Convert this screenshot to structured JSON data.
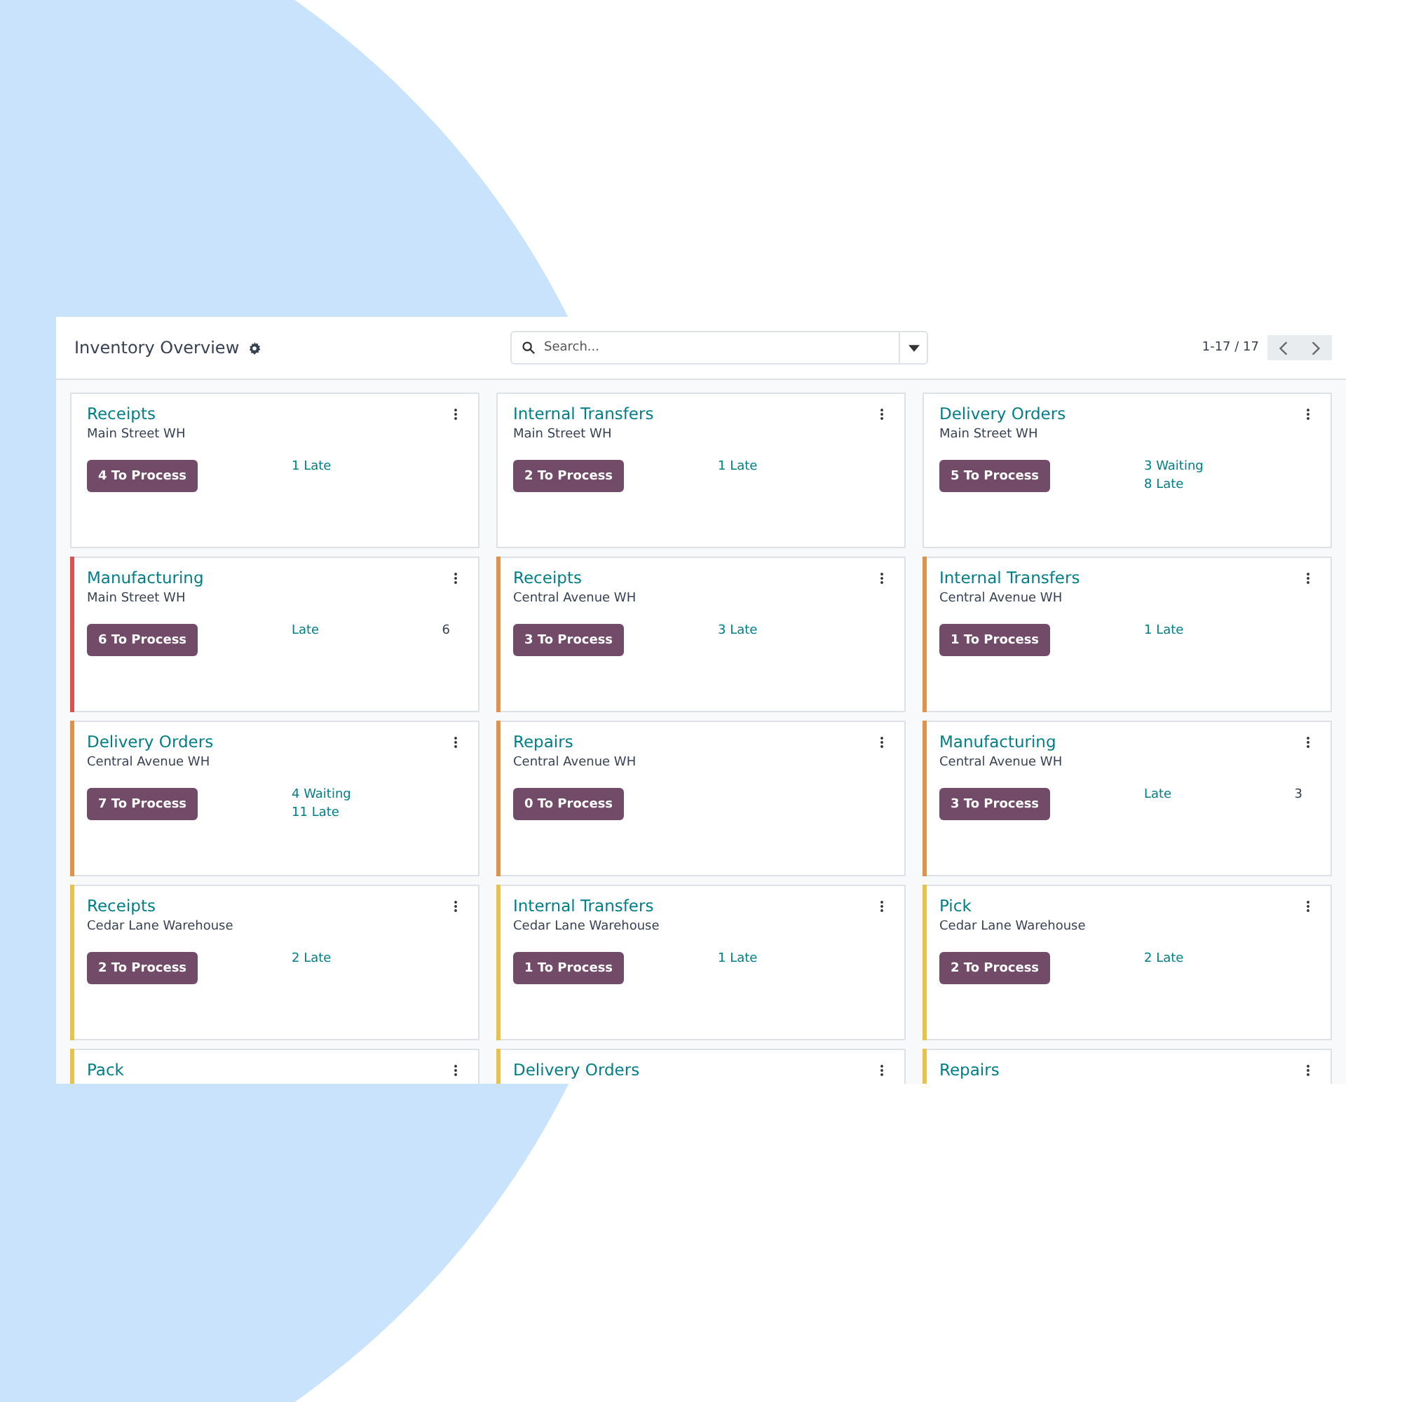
{
  "window": {
    "title": "Inventory Overview"
  },
  "search": {
    "placeholder": "Search..."
  },
  "pager": {
    "range": "1-17 / 17"
  },
  "cards": [
    {
      "title": "Receipts",
      "warehouse": "Main Street WH",
      "button": "4 To Process",
      "stats": [
        {
          "label": "1 Late"
        }
      ]
    },
    {
      "title": "Internal Transfers",
      "warehouse": "Main Street WH",
      "button": "2 To Process",
      "stats": [
        {
          "label": "1 Late"
        }
      ]
    },
    {
      "title": "Delivery Orders",
      "warehouse": "Main Street WH",
      "button": "5 To Process",
      "stats": [
        {
          "label": "3 Waiting"
        },
        {
          "label": "8 Late"
        }
      ]
    },
    {
      "title": "Manufacturing",
      "warehouse": "Main Street WH",
      "button": "6 To Process",
      "color": "#d9534f",
      "stats": [
        {
          "label": "Late",
          "count": "6"
        }
      ]
    },
    {
      "title": "Receipts",
      "warehouse": "Central Avenue WH",
      "button": "3 To Process",
      "color": "#e0924a",
      "stats": [
        {
          "label": "3 Late"
        }
      ]
    },
    {
      "title": "Internal Transfers",
      "warehouse": "Central Avenue WH",
      "button": "1 To Process",
      "color": "#e0924a",
      "stats": [
        {
          "label": "1 Late"
        }
      ]
    },
    {
      "title": "Delivery Orders",
      "warehouse": "Central Avenue WH",
      "button": "7 To Process",
      "color": "#e0924a",
      "stats": [
        {
          "label": "4 Waiting"
        },
        {
          "label": "11 Late"
        }
      ]
    },
    {
      "title": "Repairs",
      "warehouse": "Central Avenue WH",
      "button": "0 To Process",
      "color": "#e0924a"
    },
    {
      "title": "Manufacturing",
      "warehouse": "Central Avenue WH",
      "button": "3 To Process",
      "color": "#e0924a",
      "stats": [
        {
          "label": "Late",
          "count": "3"
        }
      ]
    },
    {
      "title": "Receipts",
      "warehouse": "Cedar Lane Warehouse",
      "button": "2 To Process",
      "color": "#e8c24a",
      "stats": [
        {
          "label": "2 Late"
        }
      ]
    },
    {
      "title": "Internal Transfers",
      "warehouse": "Cedar Lane Warehouse",
      "button": "1 To Process",
      "color": "#e8c24a",
      "stats": [
        {
          "label": "1 Late"
        }
      ]
    },
    {
      "title": "Pick",
      "warehouse": "Cedar Lane Warehouse",
      "button": "2 To Process",
      "color": "#e8c24a",
      "stats": [
        {
          "label": "2 Late"
        }
      ]
    },
    {
      "title": "Pack",
      "color": "#e8c24a"
    },
    {
      "title": "Delivery Orders",
      "color": "#e8c24a"
    },
    {
      "title": "Repairs",
      "color": "#e8c24a"
    }
  ]
}
